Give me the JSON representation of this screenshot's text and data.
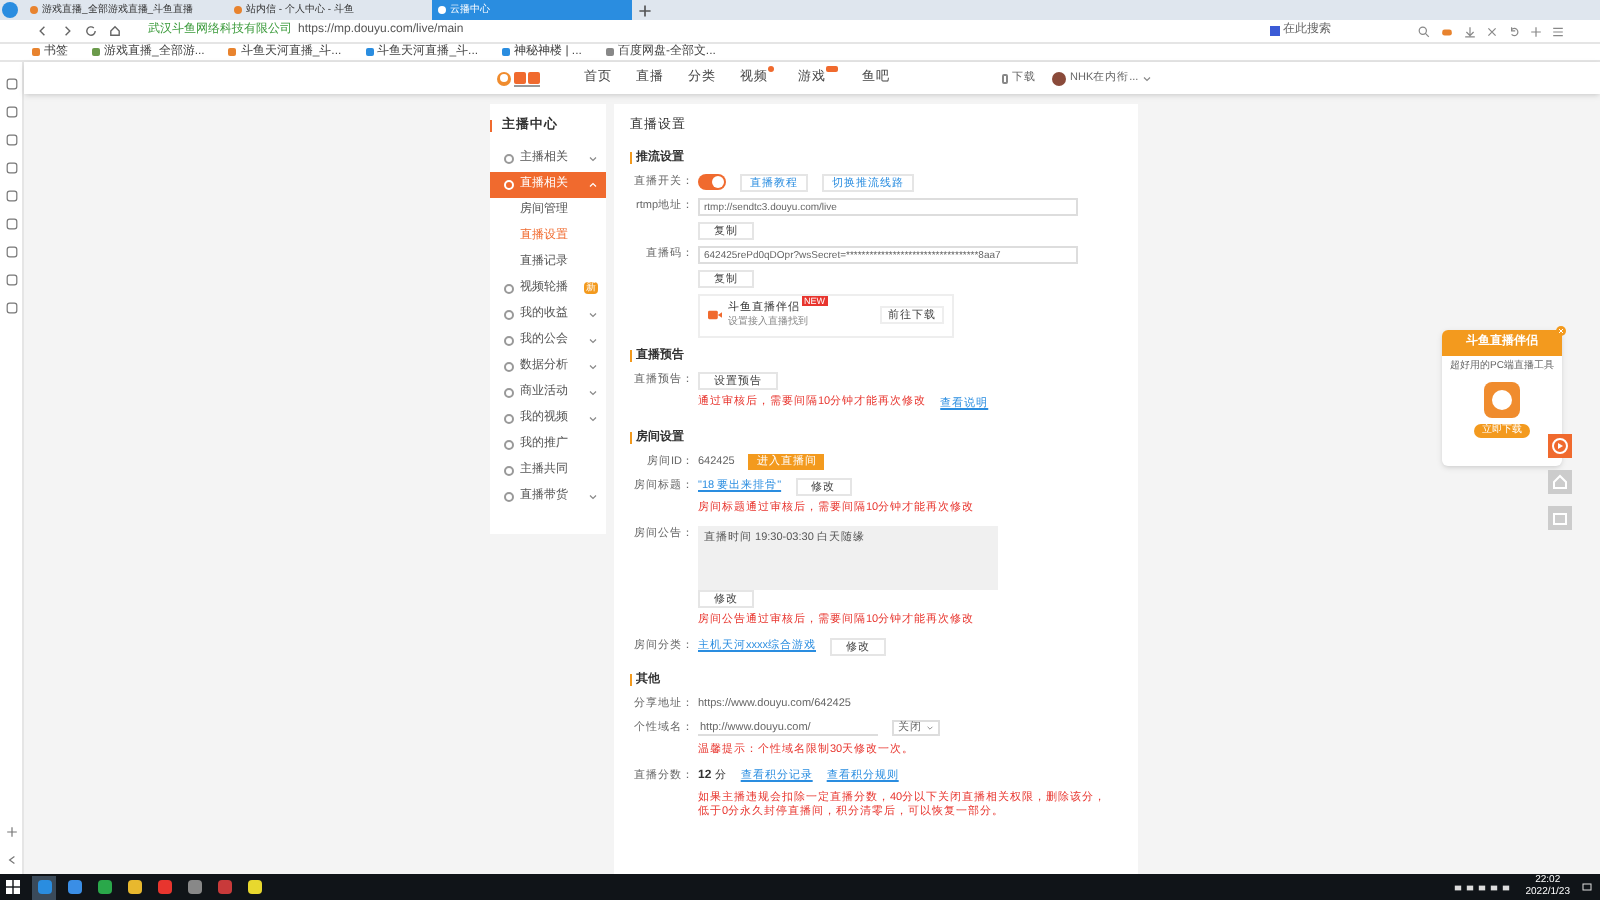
{
  "browser": {
    "tabs": [
      {
        "label": "游戏直播_全部游戏直播_斗鱼直播",
        "selected": false
      },
      {
        "label": "站内信 - 个人中心 - 斗鱼",
        "selected": false
      },
      {
        "label": "云播中心",
        "selected": true
      }
    ],
    "company": "武汉斗鱼网络科技有限公司",
    "url": "https://mp.douyu.com/live/main",
    "search_placeholder": "在此搜索",
    "bookmarks": [
      "书签",
      "游戏直播_全部游...",
      "斗鱼天河直播_斗...",
      "斗鱼天河直播_斗...",
      "神秘神楼 | ...",
      "百度网盘-全部文..."
    ]
  },
  "header": {
    "nav": [
      {
        "label": "首页",
        "has_dot": false,
        "has_new_badge": false
      },
      {
        "label": "直播",
        "has_dot": false,
        "has_new_badge": false
      },
      {
        "label": "分类",
        "has_dot": false,
        "has_new_badge": false
      },
      {
        "label": "视频",
        "has_dot": true,
        "has_new_badge": false
      },
      {
        "label": "游戏",
        "has_dot": false,
        "has_new_badge": true
      },
      {
        "label": "鱼吧",
        "has_dot": false,
        "has_new_badge": false
      }
    ],
    "download": "下载",
    "user": "NHK在内衔..."
  },
  "sidebar": {
    "title": "主播中心",
    "items": [
      {
        "label": "主播相关",
        "kind": "group",
        "expanded": false,
        "selected": false
      },
      {
        "label": "直播相关",
        "kind": "group",
        "expanded": true,
        "selected": true,
        "children": [
          {
            "label": "房间管理",
            "selected": false
          },
          {
            "label": "直播设置",
            "selected": true
          },
          {
            "label": "直播记录",
            "selected": false
          }
        ]
      },
      {
        "label": "视频轮播",
        "kind": "link",
        "selected": false,
        "badge": "新"
      },
      {
        "label": "我的收益",
        "kind": "group",
        "expanded": false,
        "selected": false
      },
      {
        "label": "我的公会",
        "kind": "group",
        "expanded": false,
        "selected": false
      },
      {
        "label": "数据分析",
        "kind": "group",
        "expanded": false,
        "selected": false
      },
      {
        "label": "商业活动",
        "kind": "group",
        "expanded": false,
        "selected": false
      },
      {
        "label": "我的视频",
        "kind": "group",
        "expanded": false,
        "selected": false
      },
      {
        "label": "我的推广",
        "kind": "link",
        "selected": false
      },
      {
        "label": "主播共同",
        "kind": "link",
        "selected": false
      },
      {
        "label": "直播带货",
        "kind": "group",
        "expanded": false,
        "selected": false
      }
    ]
  },
  "content": {
    "title": "直播设置",
    "sections": [
      {
        "title": "推流设置",
        "rows": [
          {
            "label": "直播开关：",
            "items": [
              {
                "kind": "toggle",
                "on": true
              },
              {
                "kind": "link_button",
                "text": "直播教程"
              },
              {
                "kind": "link_button",
                "text": "切换推流线路"
              }
            ]
          },
          {
            "label": "rtmp地址：",
            "items": [
              {
                "kind": "input",
                "value": "rtmp://sendtc3.douyu.com/live"
              }
            ]
          },
          {
            "items": [
              {
                "kind": "button",
                "text": "复制"
              }
            ]
          },
          {
            "label": "直播码：",
            "items": [
              {
                "kind": "input",
                "value": "642425rePd0qDOpr?wsSecret=**********************************8aa7"
              }
            ]
          },
          {
            "items": [
              {
                "kind": "button",
                "text": "复制"
              }
            ]
          },
          {
            "items": [
              {
                "kind": "promo",
                "title": "斗鱼直播伴侣",
                "badge": "NEW",
                "subtitle": "设置接入直播找到",
                "button": "前往下载"
              }
            ]
          }
        ]
      },
      {
        "title": "直播预告",
        "rows": [
          {
            "label": "直播预告：",
            "items": [
              {
                "kind": "button",
                "text": "设置预告"
              }
            ]
          },
          {
            "items": [
              {
                "kind": "note",
                "text": "通过审核后，需要间隔10分钟才能再次修改"
              },
              {
                "kind": "link",
                "text": "查看说明"
              }
            ]
          }
        ]
      },
      {
        "title": "房间设置",
        "rows": [
          {
            "label": "房间ID：",
            "items": [
              {
                "kind": "text",
                "text": "642425"
              },
              {
                "kind": "primary_button",
                "text": "进入直播间"
              }
            ]
          },
          {
            "label": "房间标题：",
            "items": [
              {
                "kind": "link",
                "text": "\"18 要出来排骨\""
              },
              {
                "kind": "button",
                "text": "修改"
              }
            ]
          },
          {
            "items": [
              {
                "kind": "note",
                "text": "房间标题通过审核后，需要间隔10分钟才能再次修改"
              }
            ]
          },
          {
            "label": "房间公告：",
            "items": [
              {
                "kind": "textarea",
                "value": "直播时间 19:30-03:30 白天随缘"
              }
            ]
          },
          {
            "items": [
              {
                "kind": "button",
                "text": "修改"
              }
            ]
          },
          {
            "items": [
              {
                "kind": "note",
                "text": "房间公告通过审核后，需要间隔10分钟才能再次修改"
              }
            ]
          },
          {
            "label": "房间分类：",
            "items": [
              {
                "kind": "link",
                "text": "主机天河xxxx综合游戏"
              },
              {
                "kind": "button",
                "text": "修改"
              }
            ]
          }
        ]
      },
      {
        "title": "其他",
        "rows": [
          {
            "label": "分享地址：",
            "items": [
              {
                "kind": "text",
                "text": "https://www.douyu.com/642425"
              }
            ]
          },
          {
            "label": "个性域名：",
            "items": [
              {
                "kind": "input_short",
                "value": "http://www.douyu.com/"
              },
              {
                "kind": "select",
                "value": "关闭"
              }
            ]
          },
          {
            "items": [
              {
                "kind": "note",
                "text": "温馨提示：个性域名限制30天修改一次。"
              }
            ]
          },
          {
            "label": "直播分数：",
            "items": [
              {
                "kind": "score",
                "text": "12",
                "unit": "分"
              },
              {
                "kind": "link",
                "text": "查看积分记录"
              },
              {
                "kind": "link",
                "text": "查看积分规则"
              }
            ]
          },
          {
            "items": [
              {
                "kind": "note",
                "text": "如果主播违规会扣除一定直播分数，40分以下关闭直播相关权限，删除该分，低于0分永久封停直播间，积分清零后，可以恢复一部分。"
              }
            ]
          }
        ]
      }
    ]
  },
  "ad": {
    "title": "斗鱼直播伴侣",
    "subtitle": "超好用的PC端直播工具",
    "button": "立即下载"
  },
  "taskbar": {
    "time": "22:02",
    "date": "2022/1/23"
  }
}
